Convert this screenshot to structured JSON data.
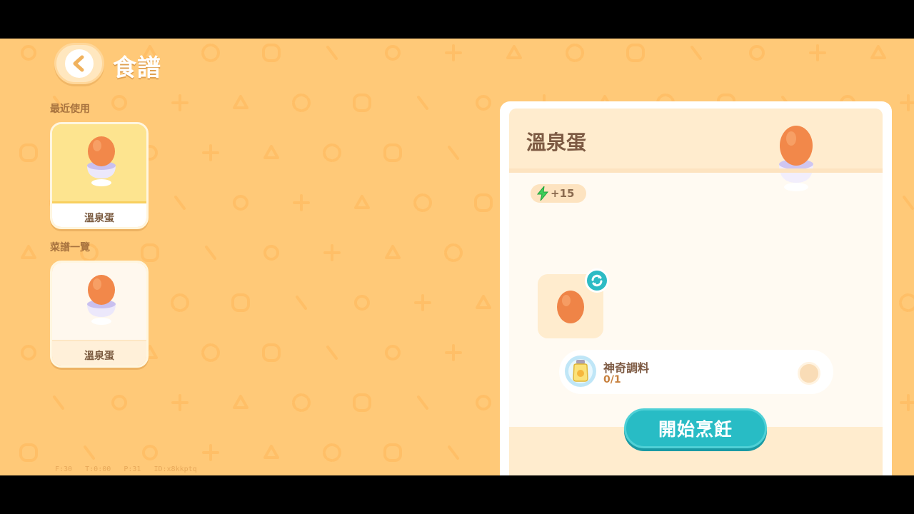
{
  "header": {
    "title": "食譜",
    "back_icon": "chevron-left-icon"
  },
  "sections": {
    "recent": "最近使用",
    "all": "菜譜一覽"
  },
  "recent_recipes": [
    {
      "name": "溫泉蛋",
      "selected": true
    }
  ],
  "all_recipes": [
    {
      "name": "溫泉蛋",
      "selected": false
    }
  ],
  "debug": "F:30   T:0:00   P:31   ID:x8kkptq",
  "detail": {
    "title": "溫泉蛋",
    "energy": "+15",
    "energy_icon": "lightning-icon",
    "ingredient_icon": "egg-icon",
    "swap_icon": "refresh-icon",
    "seasoning": {
      "name": "神奇調料",
      "count": "0/1",
      "icon": "seasoning-jar-icon"
    },
    "cook_button": "開始烹飪"
  },
  "colors": {
    "background": "#ffc978",
    "accent": "#28bcc5",
    "selected_card": "#fde48f",
    "title_text": "#7d5a43"
  }
}
